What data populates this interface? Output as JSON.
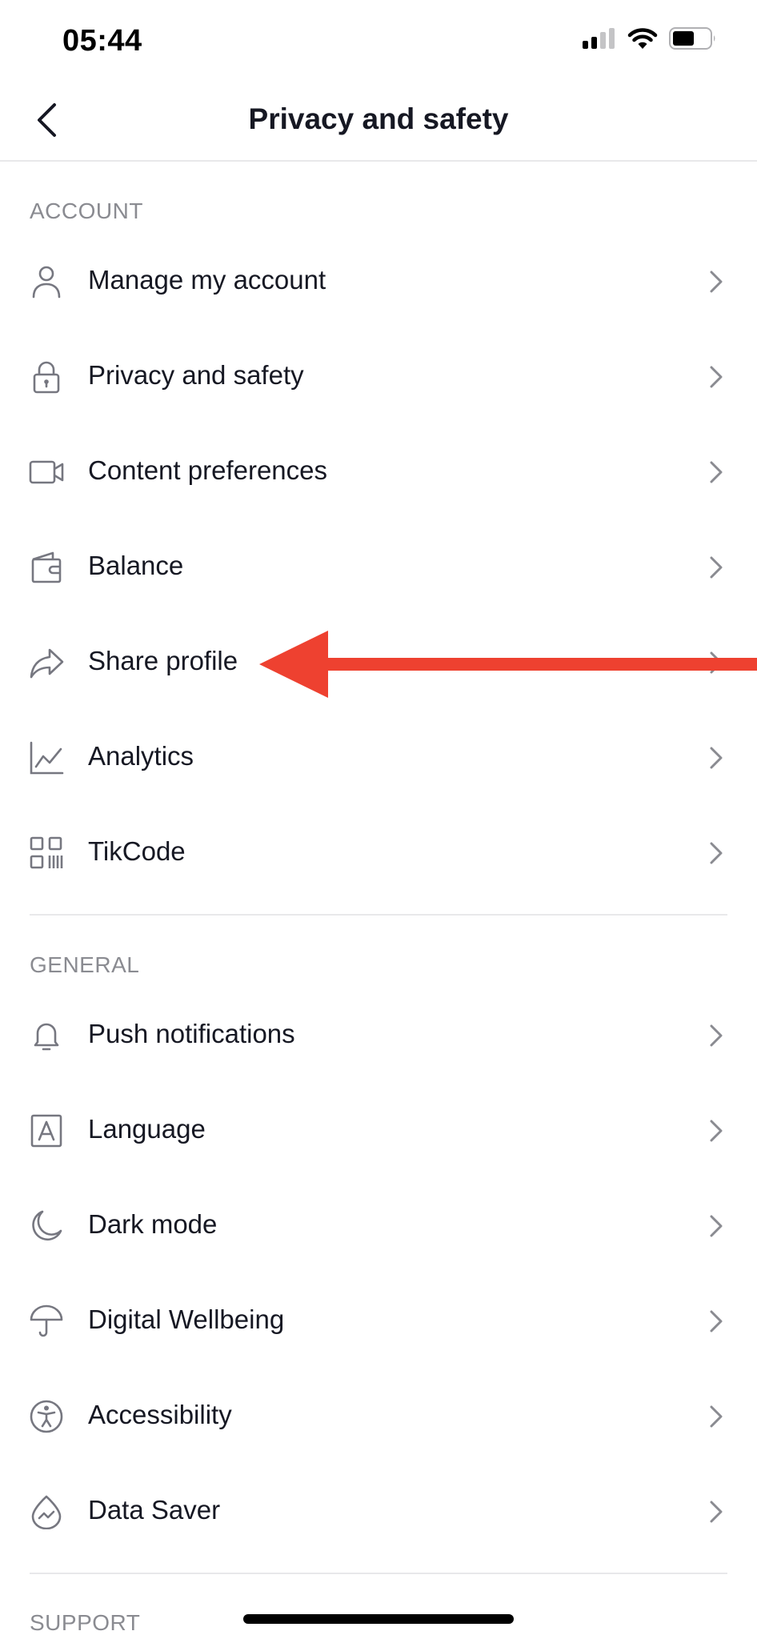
{
  "status_bar": {
    "time": "05:44",
    "battery_level": 0.6
  },
  "nav": {
    "title": "Privacy and safety"
  },
  "sections": {
    "account": {
      "header": "ACCOUNT",
      "items": [
        {
          "label": "Manage my account",
          "icon": "person-icon"
        },
        {
          "label": "Privacy and safety",
          "icon": "lock-icon"
        },
        {
          "label": "Content preferences",
          "icon": "video-camera-icon"
        },
        {
          "label": "Balance",
          "icon": "wallet-icon"
        },
        {
          "label": "Share profile",
          "icon": "share-icon"
        },
        {
          "label": "Analytics",
          "icon": "chart-icon"
        },
        {
          "label": "TikCode",
          "icon": "qr-code-icon"
        }
      ]
    },
    "general": {
      "header": "GENERAL",
      "items": [
        {
          "label": "Push notifications",
          "icon": "bell-icon"
        },
        {
          "label": "Language",
          "icon": "language-icon"
        },
        {
          "label": "Dark mode",
          "icon": "moon-icon"
        },
        {
          "label": "Digital Wellbeing",
          "icon": "umbrella-icon"
        },
        {
          "label": "Accessibility",
          "icon": "accessibility-icon"
        },
        {
          "label": "Data Saver",
          "icon": "data-saver-icon"
        }
      ]
    },
    "support": {
      "header": "SUPPORT"
    }
  },
  "colors": {
    "text": "#161823",
    "secondary_text": "#8a8b91",
    "icon": "#767780",
    "divider": "#e8e8ea",
    "annotation_arrow": "#ee4130"
  }
}
